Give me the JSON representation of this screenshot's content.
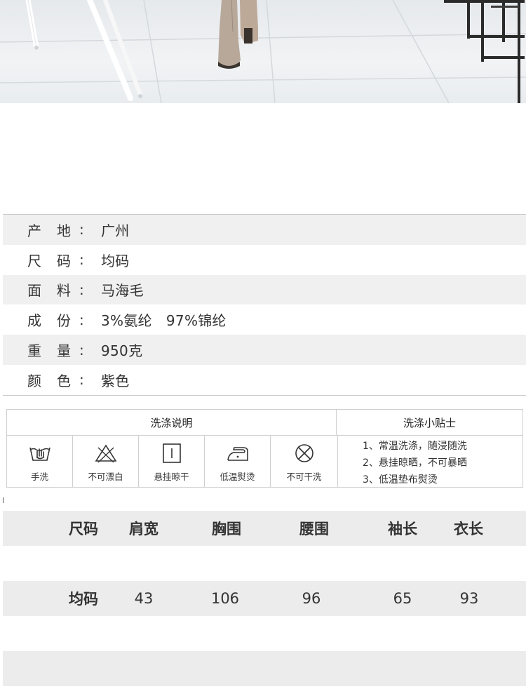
{
  "photo": {
    "alt": ""
  },
  "product_info": [
    {
      "k1": "产",
      "k2": "地",
      "colon": ":",
      "value": "广州"
    },
    {
      "k1": "尺",
      "k2": "码",
      "colon": ":",
      "value": "均码"
    },
    {
      "k1": "面",
      "k2": "料",
      "colon": ":",
      "value": "马海毛"
    },
    {
      "k1": "成",
      "k2": "份",
      "colon": ":",
      "value": "3%氨纶   97%锦纶"
    },
    {
      "k1": "重",
      "k2": "量",
      "colon": ":",
      "value": "950克"
    },
    {
      "k1": "颜",
      "k2": "色",
      "colon": ":",
      "value": "紫色"
    }
  ],
  "care": {
    "title_left": "洗涤说明",
    "title_right": "洗涤小贴士",
    "icons": [
      {
        "icon": "hand-wash-icon",
        "label": "手洗"
      },
      {
        "icon": "no-bleach-icon",
        "label": "不可漂白"
      },
      {
        "icon": "hang-dry-icon",
        "label": "悬挂晾干"
      },
      {
        "icon": "low-iron-icon",
        "label": "低温熨烫"
      },
      {
        "icon": "no-dry-clean-icon",
        "label": "不可干洗"
      }
    ],
    "tips": [
      "1、常温洗涤，随浸随洗",
      "2、悬挂晾晒，不可暴晒",
      "3、低温垫布熨烫"
    ]
  },
  "size_table": {
    "headers": [
      "尺码",
      "肩宽",
      "胸围",
      "腰围",
      "袖长",
      "衣长"
    ],
    "rows": [
      [
        "均码",
        "43",
        "106",
        "96",
        "65",
        "93"
      ]
    ]
  }
}
